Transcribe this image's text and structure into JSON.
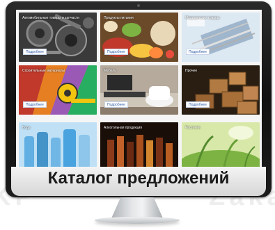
{
  "catalog": {
    "title": "Каталог предложений",
    "button_label": "Подробнее",
    "categories": [
      {
        "label": "Автомобильные товары и запчасти",
        "icon": "auto-parts-image"
      },
      {
        "label": "Продукты питания",
        "icon": "food-image"
      },
      {
        "label": "Медицинские товары",
        "icon": "medical-image"
      },
      {
        "label": "Строительные материалы",
        "icon": "construction-image"
      },
      {
        "label": "Мебель",
        "icon": "furniture-image"
      },
      {
        "label": "Прочее",
        "icon": "boxes-image"
      },
      {
        "label": "Вода",
        "icon": "water-image"
      },
      {
        "label": "Алкогольная продукция",
        "icon": "alcohol-image"
      },
      {
        "label": "Растения",
        "icon": "plants-image"
      }
    ]
  },
  "watermark": {
    "left": "KP",
    "right": "Zaka"
  }
}
